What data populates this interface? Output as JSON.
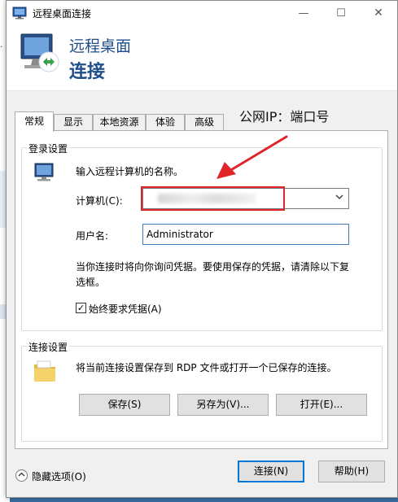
{
  "window": {
    "title": "远程桌面连接",
    "controls": {
      "minimize": "—",
      "maximize": "☐",
      "close": "✕"
    }
  },
  "banner": {
    "line1": "远程桌面",
    "line2": "连接"
  },
  "annotation": "公网IP：端口号",
  "tabs": [
    "常规",
    "显示",
    "本地资源",
    "体验",
    "高级"
  ],
  "login": {
    "group_label": "登录设置",
    "intro": "输入远程计算机的名称。",
    "computer_label": "计算机(C):",
    "username_label": "用户名:",
    "username_value": "Administrator",
    "note_line1": "当你连接时将向你询问凭据。要使用保存的凭据，请清除以下复",
    "note_line2": "选框。",
    "always_ask_label": "始终要求凭据(A)",
    "always_ask_checked": "✓"
  },
  "connection": {
    "group_label": "连接设置",
    "desc": "将当前连接设置保存到 RDP 文件或打开一个已保存的连接。",
    "save_button": "保存(S)",
    "save_as_button": "另存为(V)...",
    "open_button": "打开(E)..."
  },
  "footer": {
    "hide_options": "隐藏选项(O)",
    "connect_button": "连接(N)",
    "help_button": "帮助(H)"
  },
  "colors": {
    "accent": "#1f4e8c",
    "annotation_red": "#e0242a",
    "focus_blue": "#0078d7"
  }
}
